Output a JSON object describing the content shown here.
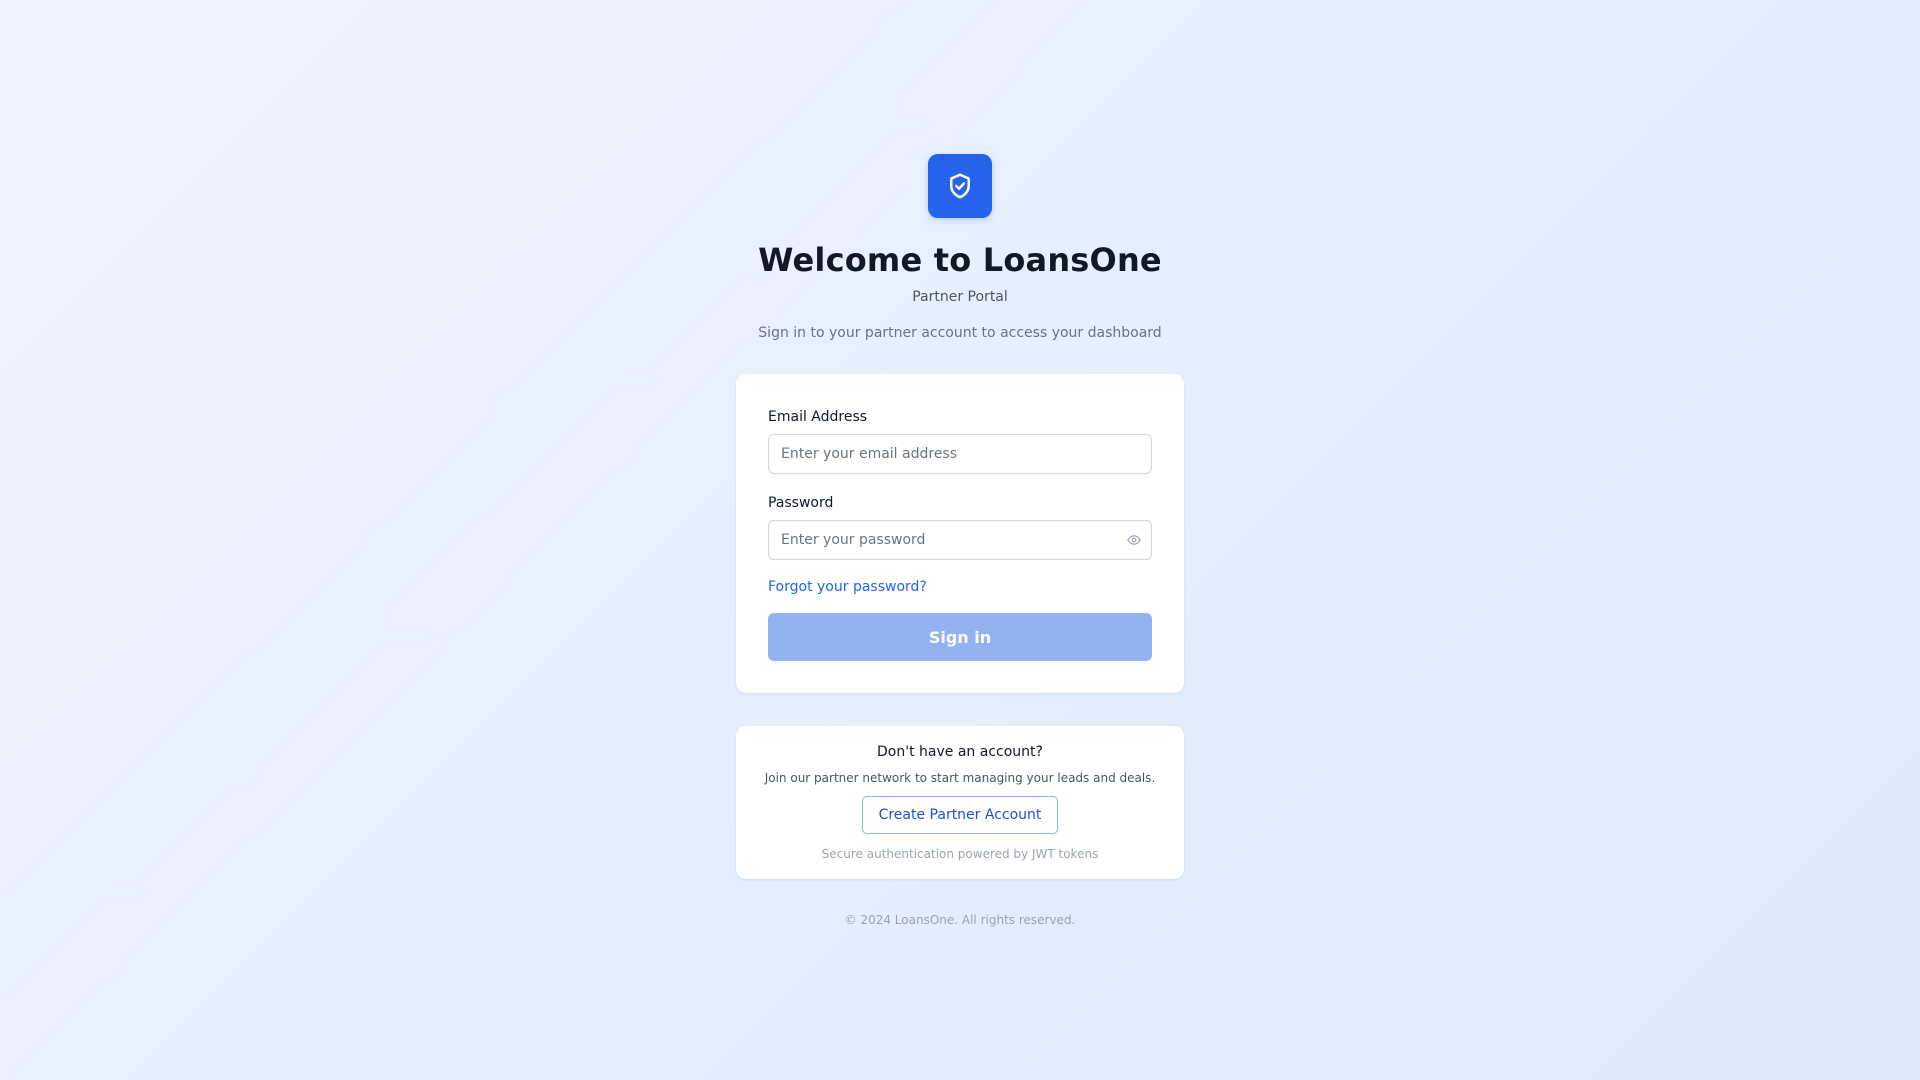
{
  "brand": {
    "title": "Welcome to LoansOne",
    "subtitle": "Partner Portal",
    "tagline": "Sign in to your partner account to access your dashboard",
    "logo_icon": "shield-check-icon",
    "accent_color": "#2563eb"
  },
  "login_form": {
    "email_label": "Email Address",
    "email_placeholder": "Enter your email address",
    "email_value": "",
    "password_label": "Password",
    "password_placeholder": "Enter your password",
    "password_value": "",
    "password_toggle_icon": "eye-icon",
    "forgot_link": "Forgot your password?",
    "submit_label": "Sign in",
    "submit_disabled_color": "#93b2f1"
  },
  "signup": {
    "title": "Don't have an account?",
    "description": "Join our partner network to start managing your leads and deals.",
    "button_label": "Create Partner Account",
    "security_note": "Secure authentication powered by JWT tokens"
  },
  "footer": {
    "copyright": "© 2024 LoansOne. All rights reserved."
  }
}
